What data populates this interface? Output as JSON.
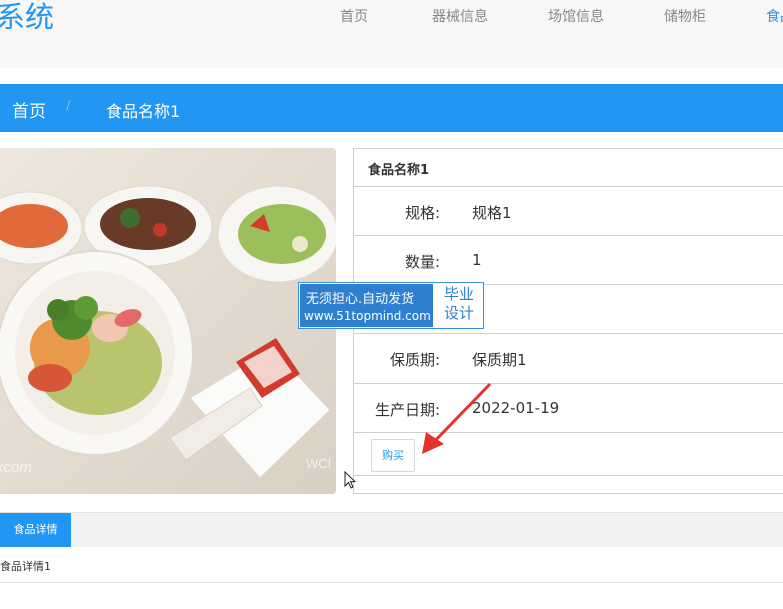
{
  "header": {
    "logo": "系统",
    "nav": [
      {
        "label": "首页"
      },
      {
        "label": "器械信息"
      },
      {
        "label": "场馆信息"
      },
      {
        "label": "储物柜"
      },
      {
        "label": "食品"
      }
    ]
  },
  "breadcrumb": {
    "home": "首页",
    "separator": "/",
    "current": "食品名称1"
  },
  "product": {
    "title": "食品名称1",
    "fields": [
      {
        "label": "规格:",
        "value": "规格1"
      },
      {
        "label": "数量:",
        "value": "1"
      },
      {
        "label": "",
        "value": ""
      },
      {
        "label": "保质期:",
        "value": "保质期1"
      },
      {
        "label": "生产日期:",
        "value": "2022-01-19"
      }
    ],
    "buy_label": "购买"
  },
  "watermark": {
    "line1": "无须担心.自动发货",
    "line2": "www.51topmind.com",
    "right_line1": "毕业",
    "right_line2": "设计"
  },
  "photo_watermarks": {
    "left": "xcom",
    "right": "WCI"
  },
  "tabs": {
    "active": "食品详情"
  },
  "detail": {
    "text": "食品详情1"
  },
  "colors": {
    "accent": "#2196f3",
    "header_bg": "#f7f7f7",
    "watermark_blue": "#2f7fd0"
  }
}
